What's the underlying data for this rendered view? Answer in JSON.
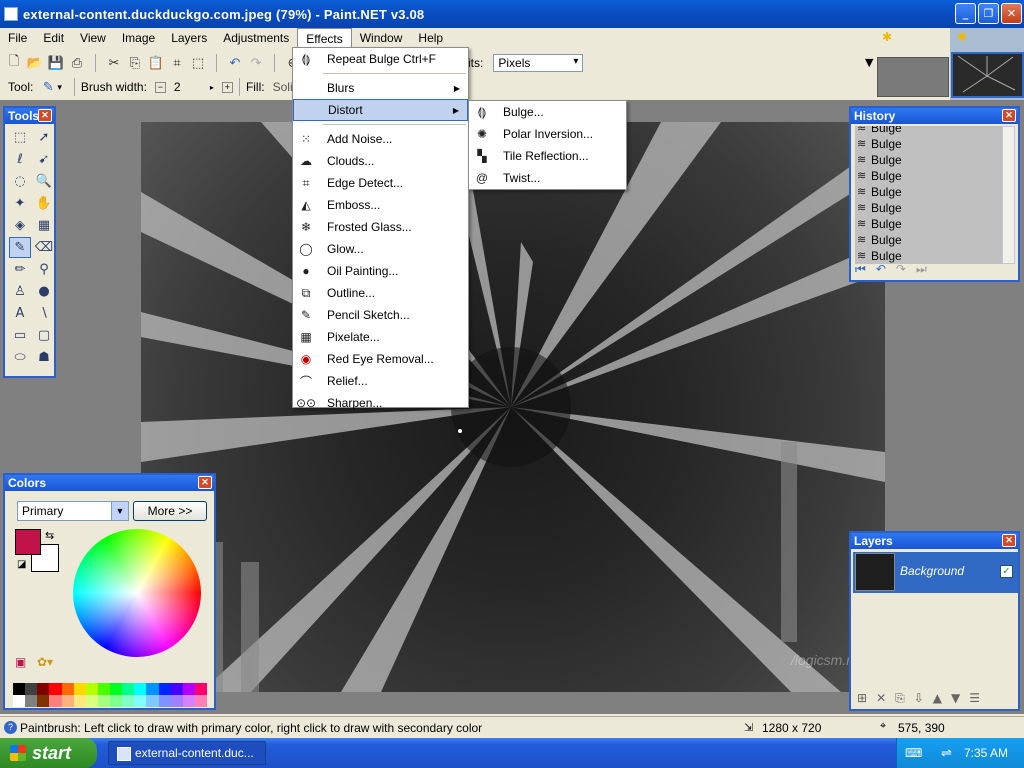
{
  "window": {
    "title": "external-content.duckduckgo.com.jpeg (79%) - Paint.NET v3.08"
  },
  "menubar": [
    "File",
    "Edit",
    "View",
    "Image",
    "Layers",
    "Adjustments",
    "Effects",
    "Window",
    "Help"
  ],
  "toolbar": {
    "tool_label": "Tool:",
    "brush_width_label": "Brush width:",
    "brush_width_value": "2",
    "fill_label": "Fill:",
    "fill_value": "Solic",
    "units_label": "its:",
    "units_value": "Pixels"
  },
  "effects_menu": {
    "repeat": {
      "label": "Repeat Bulge",
      "shortcut": "Ctrl+F"
    },
    "items": [
      {
        "label": "Blurs",
        "submenu": true
      },
      {
        "label": "Distort",
        "submenu": true
      },
      {
        "label": "Add Noise..."
      },
      {
        "label": "Clouds..."
      },
      {
        "label": "Edge Detect..."
      },
      {
        "label": "Emboss..."
      },
      {
        "label": "Frosted Glass..."
      },
      {
        "label": "Glow..."
      },
      {
        "label": "Oil Painting..."
      },
      {
        "label": "Outline..."
      },
      {
        "label": "Pencil Sketch..."
      },
      {
        "label": "Pixelate..."
      },
      {
        "label": "Red Eye Removal..."
      },
      {
        "label": "Relief..."
      },
      {
        "label": "Sharpen..."
      }
    ]
  },
  "distort_menu": [
    "Bulge...",
    "Polar Inversion...",
    "Tile Reflection...",
    "Twist..."
  ],
  "panels": {
    "tools_title": "Tools",
    "colors_title": "Colors",
    "colors_mode": "Primary",
    "more_button": "More >>",
    "history_title": "History",
    "history_items": [
      "Bulge",
      "Bulge",
      "Bulge",
      "Bulge",
      "Bulge",
      "Bulge",
      "Bulge",
      "Bulge",
      "Bulge"
    ],
    "layers_title": "Layers",
    "layer_name": "Background"
  },
  "canvas": {
    "watermark": "/logicsm.net"
  },
  "statusbar": {
    "hint": "Paintbrush: Left click to draw with primary color, right click to draw with secondary color",
    "image_size": "1280 x 720",
    "cursor": "575, 390"
  },
  "taskbar": {
    "start": "start",
    "task": "external-content.duc...",
    "clock": "7:35 AM"
  },
  "colors": {
    "primary": "#c0134a",
    "secondary": "#ffffff",
    "accent": "#316ac5",
    "palette": [
      "#000000",
      "#404040",
      "#7f0000",
      "#ff0000",
      "#ff6a00",
      "#ffd800",
      "#b6ff00",
      "#4cff00",
      "#00ff21",
      "#00ff90",
      "#00ffff",
      "#0094ff",
      "#0026ff",
      "#4800ff",
      "#b200ff",
      "#ff006e",
      "#ffffff",
      "#808080",
      "#7f3300",
      "#ff7f7f",
      "#ffb27f",
      "#ffe97f",
      "#daff7f",
      "#a5ff7f",
      "#7fff8e",
      "#7fffc5",
      "#7fffff",
      "#7fc9ff",
      "#7f92ff",
      "#a17fff",
      "#d67fff",
      "#ff7fb6"
    ]
  }
}
